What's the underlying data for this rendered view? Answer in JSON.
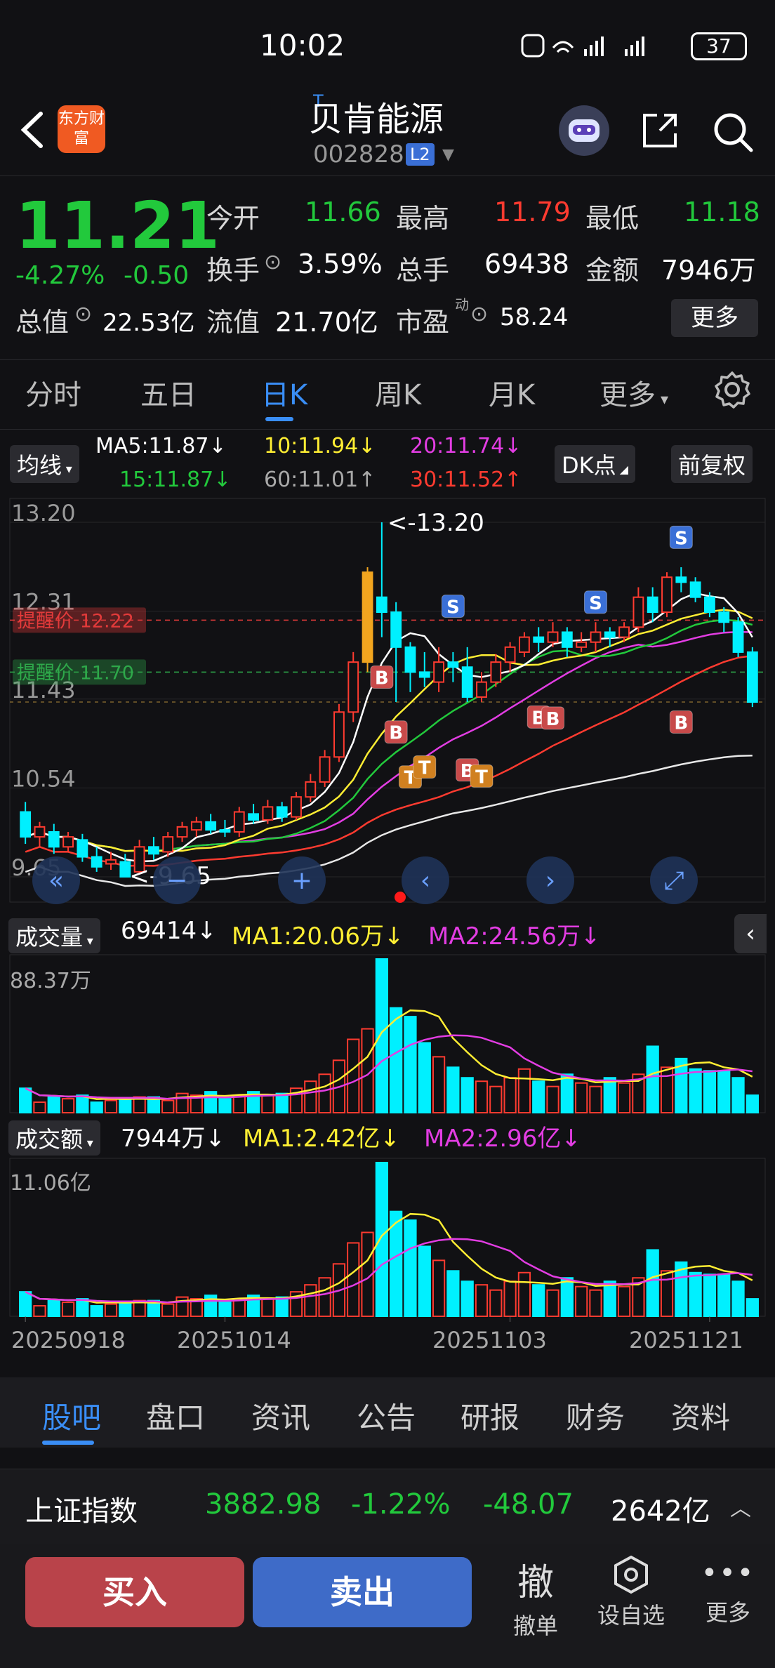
{
  "status_bar": {
    "time": "10:02",
    "network": "5G 4G",
    "battery": "37"
  },
  "header": {
    "app_logo": "东方财富",
    "stock_name": "贝肯能源",
    "stock_mark": "T",
    "stock_code": "002828",
    "level_badge": "L2"
  },
  "quote": {
    "last_price": "11.21",
    "pct_change": "-4.27%",
    "abs_change": "-0.50",
    "open_label": "今开",
    "open": "11.66",
    "high_label": "最高",
    "high": "11.79",
    "low_label": "最低",
    "low": "11.18",
    "turnover_label": "换手",
    "turnover": "3.59%",
    "volume_label": "总手",
    "volume": "69438",
    "amount_label": "金额",
    "amount": "7946万",
    "mktcap_label": "总值",
    "mktcap": "22.53亿",
    "float_label": "流值",
    "float_cap": "21.70亿",
    "pe_label": "市盈",
    "pe_sup": "动",
    "pe": "58.24",
    "more_label": "更多"
  },
  "period_tabs": [
    "分时",
    "五日",
    "日K",
    "周K",
    "月K",
    "更多"
  ],
  "active_period": "日K",
  "ma_legend": {
    "toggle_label": "均线",
    "ma5": "MA5:11.87↓",
    "ma10": "10:11.94↓",
    "ma20": "20:11.74↓",
    "ma15": "15:11.87↓",
    "ma60": "60:11.01↑",
    "ma30": "30:11.52↑",
    "dk_label": "DK点",
    "adjust_label": "前复权"
  },
  "chart_data": {
    "type": "candlestick",
    "price_axis_labels": [
      "13.20",
      "12.31",
      "11.43",
      "10.54",
      "9.65"
    ],
    "ylim": [
      9.65,
      13.2
    ],
    "max_marker": "<-13.20",
    "min_marker": "<-9.65",
    "alert_lines": [
      {
        "label": "提醒价 12.22",
        "value": 12.22,
        "color": "#e23a3a"
      },
      {
        "label": "提醒价 11.70",
        "value": 11.7,
        "color": "#2ea84a"
      }
    ],
    "dates": [
      "20250918",
      "20251014",
      "20251103",
      "20251121"
    ],
    "candles": [
      [
        10.3,
        10.05,
        10.4,
        9.98
      ],
      [
        10.05,
        10.15,
        10.2,
        9.95
      ],
      [
        10.1,
        9.95,
        10.18,
        9.88
      ],
      [
        9.95,
        10.05,
        10.1,
        9.9
      ],
      [
        10.02,
        9.85,
        10.08,
        9.8
      ],
      [
        9.85,
        9.75,
        9.95,
        9.7
      ],
      [
        9.78,
        9.82,
        9.9,
        9.72
      ],
      [
        9.8,
        9.65,
        9.88,
        9.65
      ],
      [
        9.7,
        9.95,
        10.02,
        9.68
      ],
      [
        9.95,
        9.88,
        10.05,
        9.82
      ],
      [
        9.9,
        10.05,
        10.1,
        9.85
      ],
      [
        10.05,
        10.15,
        10.2,
        10.0
      ],
      [
        10.12,
        10.2,
        10.25,
        10.05
      ],
      [
        10.2,
        10.12,
        10.28,
        10.08
      ],
      [
        10.12,
        10.1,
        10.22,
        10.05
      ],
      [
        10.1,
        10.3,
        10.35,
        10.05
      ],
      [
        10.28,
        10.22,
        10.38,
        10.18
      ],
      [
        10.22,
        10.35,
        10.42,
        10.18
      ],
      [
        10.35,
        10.25,
        10.4,
        10.2
      ],
      [
        10.25,
        10.45,
        10.5,
        10.22
      ],
      [
        10.45,
        10.6,
        10.68,
        10.4
      ],
      [
        10.6,
        10.85,
        10.92,
        10.55
      ],
      [
        10.85,
        11.3,
        11.38,
        10.8
      ],
      [
        11.3,
        11.8,
        11.9,
        11.2
      ],
      [
        11.8,
        12.7,
        12.75,
        11.7
      ],
      [
        12.45,
        12.3,
        13.2,
        12.05
      ],
      [
        12.3,
        11.95,
        12.4,
        11.4
      ],
      [
        11.95,
        11.7,
        12.0,
        11.5
      ],
      [
        11.7,
        11.65,
        11.9,
        11.55
      ],
      [
        11.6,
        11.8,
        11.95,
        11.5
      ],
      [
        11.8,
        11.75,
        11.9,
        11.6
      ],
      [
        11.75,
        11.45,
        11.95,
        11.4
      ],
      [
        11.45,
        11.6,
        11.7,
        11.4
      ],
      [
        11.6,
        11.8,
        11.88,
        11.55
      ],
      [
        11.8,
        11.95,
        12.0,
        11.7
      ],
      [
        11.9,
        12.05,
        12.1,
        11.85
      ],
      [
        12.05,
        12.0,
        12.15,
        11.9
      ],
      [
        12.0,
        12.1,
        12.2,
        11.95
      ],
      [
        12.1,
        11.95,
        12.15,
        11.85
      ],
      [
        11.95,
        12.0,
        12.1,
        11.9
      ],
      [
        12.0,
        12.1,
        12.2,
        11.9
      ],
      [
        12.1,
        12.05,
        12.15,
        11.95
      ],
      [
        12.05,
        12.15,
        12.2,
        12.0
      ],
      [
        12.15,
        12.45,
        12.55,
        12.1
      ],
      [
        12.45,
        12.3,
        12.55,
        12.2
      ],
      [
        12.3,
        12.65,
        12.7,
        12.25
      ],
      [
        12.65,
        12.6,
        12.75,
        12.5
      ],
      [
        12.6,
        12.45,
        12.65,
        12.4
      ],
      [
        12.45,
        12.3,
        12.5,
        12.25
      ],
      [
        12.3,
        12.2,
        12.35,
        12.1
      ],
      [
        12.2,
        11.9,
        12.25,
        11.85
      ],
      [
        11.9,
        11.4,
        11.95,
        11.35
      ]
    ],
    "volume_header": {
      "label": "成交量",
      "value": "69414↓",
      "ma1": "MA1:20.06万↓",
      "ma2": "MA2:24.56万↓",
      "axis_max": "88.37万"
    },
    "volume": [
      14,
      6,
      9,
      8,
      10,
      6,
      7,
      8,
      9,
      9,
      7,
      11,
      10,
      12,
      8,
      10,
      12,
      10,
      11,
      14,
      18,
      22,
      30,
      42,
      48,
      88,
      60,
      55,
      40,
      32,
      26,
      20,
      18,
      15,
      20,
      25,
      18,
      15,
      22,
      17,
      15,
      20,
      17,
      22,
      38,
      26,
      31,
      25,
      24,
      24,
      20,
      10
    ],
    "amount_header": {
      "label": "成交额",
      "value": "7944万↓",
      "ma1": "MA1:2.42亿↓",
      "ma2": "MA2:2.96亿↓",
      "axis_max": "11.06亿"
    }
  },
  "signals": {
    "buy": "B",
    "sell": "S",
    "t": "T"
  },
  "info_tabs": [
    "股吧",
    "盘口",
    "资讯",
    "公告",
    "研报",
    "财务",
    "资料"
  ],
  "active_info_tab": "股吧",
  "index_bar": {
    "name": "上证指数",
    "value": "3882.98",
    "pct": "-1.22%",
    "change": "-48.07",
    "amount": "2642亿"
  },
  "actions": {
    "buy": "买入",
    "sell": "卖出",
    "cancel": "撤单",
    "cancel_big": "撤",
    "watch": "设自选",
    "more": "更多"
  },
  "colors": {
    "up": "#ff3b30",
    "down": "#22c93c",
    "accent": "#3a8ef6",
    "cyan": "#00f0ff"
  }
}
